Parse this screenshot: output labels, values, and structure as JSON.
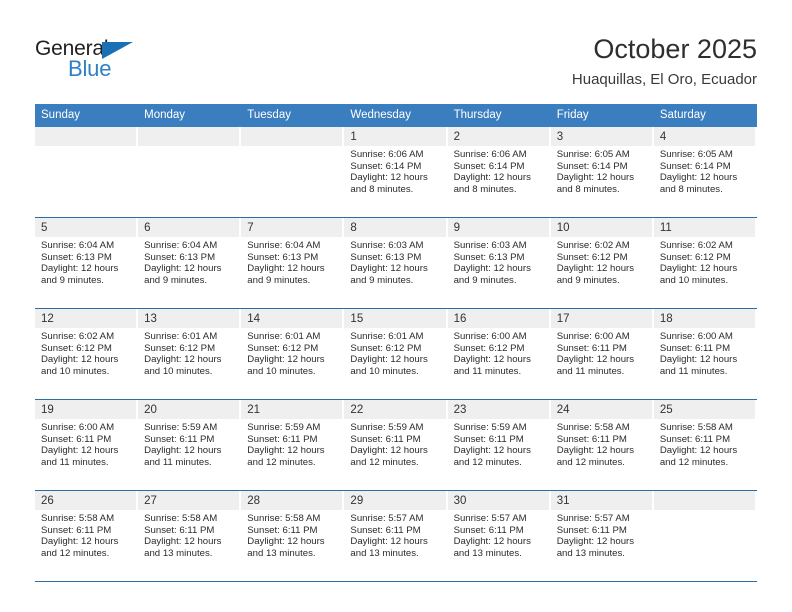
{
  "logo": {
    "word_top": "General",
    "word_bottom": "Blue",
    "triangle_color": "#1a6fb5",
    "blue_color": "#2f80c7"
  },
  "header": {
    "title": "October 2025",
    "subtitle": "Huaquillas, El Oro, Ecuador"
  },
  "theme": {
    "header_row_bg": "#3a7ebf",
    "row_divider": "#2e6da4",
    "daynum_band_bg": "#efefef"
  },
  "weekday_headers": [
    "Sunday",
    "Monday",
    "Tuesday",
    "Wednesday",
    "Thursday",
    "Friday",
    "Saturday"
  ],
  "weeks": [
    [
      {
        "day": "",
        "empty": true
      },
      {
        "day": "",
        "empty": true
      },
      {
        "day": "",
        "empty": true
      },
      {
        "day": "1",
        "sunrise": "Sunrise: 6:06 AM",
        "sunset": "Sunset: 6:14 PM",
        "daylight_line1": "Daylight: 12 hours",
        "daylight_line2": "and 8 minutes."
      },
      {
        "day": "2",
        "sunrise": "Sunrise: 6:06 AM",
        "sunset": "Sunset: 6:14 PM",
        "daylight_line1": "Daylight: 12 hours",
        "daylight_line2": "and 8 minutes."
      },
      {
        "day": "3",
        "sunrise": "Sunrise: 6:05 AM",
        "sunset": "Sunset: 6:14 PM",
        "daylight_line1": "Daylight: 12 hours",
        "daylight_line2": "and 8 minutes."
      },
      {
        "day": "4",
        "sunrise": "Sunrise: 6:05 AM",
        "sunset": "Sunset: 6:14 PM",
        "daylight_line1": "Daylight: 12 hours",
        "daylight_line2": "and 8 minutes."
      }
    ],
    [
      {
        "day": "5",
        "sunrise": "Sunrise: 6:04 AM",
        "sunset": "Sunset: 6:13 PM",
        "daylight_line1": "Daylight: 12 hours",
        "daylight_line2": "and 9 minutes."
      },
      {
        "day": "6",
        "sunrise": "Sunrise: 6:04 AM",
        "sunset": "Sunset: 6:13 PM",
        "daylight_line1": "Daylight: 12 hours",
        "daylight_line2": "and 9 minutes."
      },
      {
        "day": "7",
        "sunrise": "Sunrise: 6:04 AM",
        "sunset": "Sunset: 6:13 PM",
        "daylight_line1": "Daylight: 12 hours",
        "daylight_line2": "and 9 minutes."
      },
      {
        "day": "8",
        "sunrise": "Sunrise: 6:03 AM",
        "sunset": "Sunset: 6:13 PM",
        "daylight_line1": "Daylight: 12 hours",
        "daylight_line2": "and 9 minutes."
      },
      {
        "day": "9",
        "sunrise": "Sunrise: 6:03 AM",
        "sunset": "Sunset: 6:13 PM",
        "daylight_line1": "Daylight: 12 hours",
        "daylight_line2": "and 9 minutes."
      },
      {
        "day": "10",
        "sunrise": "Sunrise: 6:02 AM",
        "sunset": "Sunset: 6:12 PM",
        "daylight_line1": "Daylight: 12 hours",
        "daylight_line2": "and 9 minutes."
      },
      {
        "day": "11",
        "sunrise": "Sunrise: 6:02 AM",
        "sunset": "Sunset: 6:12 PM",
        "daylight_line1": "Daylight: 12 hours",
        "daylight_line2": "and 10 minutes."
      }
    ],
    [
      {
        "day": "12",
        "sunrise": "Sunrise: 6:02 AM",
        "sunset": "Sunset: 6:12 PM",
        "daylight_line1": "Daylight: 12 hours",
        "daylight_line2": "and 10 minutes."
      },
      {
        "day": "13",
        "sunrise": "Sunrise: 6:01 AM",
        "sunset": "Sunset: 6:12 PM",
        "daylight_line1": "Daylight: 12 hours",
        "daylight_line2": "and 10 minutes."
      },
      {
        "day": "14",
        "sunrise": "Sunrise: 6:01 AM",
        "sunset": "Sunset: 6:12 PM",
        "daylight_line1": "Daylight: 12 hours",
        "daylight_line2": "and 10 minutes."
      },
      {
        "day": "15",
        "sunrise": "Sunrise: 6:01 AM",
        "sunset": "Sunset: 6:12 PM",
        "daylight_line1": "Daylight: 12 hours",
        "daylight_line2": "and 10 minutes."
      },
      {
        "day": "16",
        "sunrise": "Sunrise: 6:00 AM",
        "sunset": "Sunset: 6:12 PM",
        "daylight_line1": "Daylight: 12 hours",
        "daylight_line2": "and 11 minutes."
      },
      {
        "day": "17",
        "sunrise": "Sunrise: 6:00 AM",
        "sunset": "Sunset: 6:11 PM",
        "daylight_line1": "Daylight: 12 hours",
        "daylight_line2": "and 11 minutes."
      },
      {
        "day": "18",
        "sunrise": "Sunrise: 6:00 AM",
        "sunset": "Sunset: 6:11 PM",
        "daylight_line1": "Daylight: 12 hours",
        "daylight_line2": "and 11 minutes."
      }
    ],
    [
      {
        "day": "19",
        "sunrise": "Sunrise: 6:00 AM",
        "sunset": "Sunset: 6:11 PM",
        "daylight_line1": "Daylight: 12 hours",
        "daylight_line2": "and 11 minutes."
      },
      {
        "day": "20",
        "sunrise": "Sunrise: 5:59 AM",
        "sunset": "Sunset: 6:11 PM",
        "daylight_line1": "Daylight: 12 hours",
        "daylight_line2": "and 11 minutes."
      },
      {
        "day": "21",
        "sunrise": "Sunrise: 5:59 AM",
        "sunset": "Sunset: 6:11 PM",
        "daylight_line1": "Daylight: 12 hours",
        "daylight_line2": "and 12 minutes."
      },
      {
        "day": "22",
        "sunrise": "Sunrise: 5:59 AM",
        "sunset": "Sunset: 6:11 PM",
        "daylight_line1": "Daylight: 12 hours",
        "daylight_line2": "and 12 minutes."
      },
      {
        "day": "23",
        "sunrise": "Sunrise: 5:59 AM",
        "sunset": "Sunset: 6:11 PM",
        "daylight_line1": "Daylight: 12 hours",
        "daylight_line2": "and 12 minutes."
      },
      {
        "day": "24",
        "sunrise": "Sunrise: 5:58 AM",
        "sunset": "Sunset: 6:11 PM",
        "daylight_line1": "Daylight: 12 hours",
        "daylight_line2": "and 12 minutes."
      },
      {
        "day": "25",
        "sunrise": "Sunrise: 5:58 AM",
        "sunset": "Sunset: 6:11 PM",
        "daylight_line1": "Daylight: 12 hours",
        "daylight_line2": "and 12 minutes."
      }
    ],
    [
      {
        "day": "26",
        "sunrise": "Sunrise: 5:58 AM",
        "sunset": "Sunset: 6:11 PM",
        "daylight_line1": "Daylight: 12 hours",
        "daylight_line2": "and 12 minutes."
      },
      {
        "day": "27",
        "sunrise": "Sunrise: 5:58 AM",
        "sunset": "Sunset: 6:11 PM",
        "daylight_line1": "Daylight: 12 hours",
        "daylight_line2": "and 13 minutes."
      },
      {
        "day": "28",
        "sunrise": "Sunrise: 5:58 AM",
        "sunset": "Sunset: 6:11 PM",
        "daylight_line1": "Daylight: 12 hours",
        "daylight_line2": "and 13 minutes."
      },
      {
        "day": "29",
        "sunrise": "Sunrise: 5:57 AM",
        "sunset": "Sunset: 6:11 PM",
        "daylight_line1": "Daylight: 12 hours",
        "daylight_line2": "and 13 minutes."
      },
      {
        "day": "30",
        "sunrise": "Sunrise: 5:57 AM",
        "sunset": "Sunset: 6:11 PM",
        "daylight_line1": "Daylight: 12 hours",
        "daylight_line2": "and 13 minutes."
      },
      {
        "day": "31",
        "sunrise": "Sunrise: 5:57 AM",
        "sunset": "Sunset: 6:11 PM",
        "daylight_line1": "Daylight: 12 hours",
        "daylight_line2": "and 13 minutes."
      },
      {
        "day": "",
        "empty": true
      }
    ]
  ]
}
